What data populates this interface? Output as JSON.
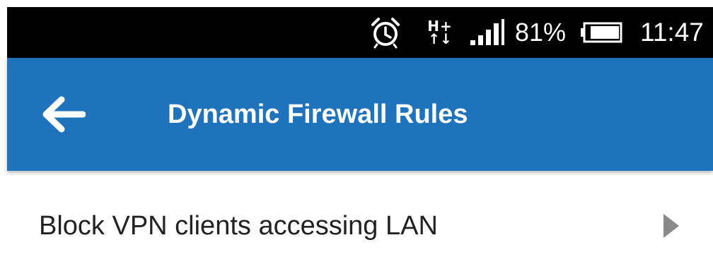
{
  "status_bar": {
    "network_type": "H+",
    "battery_percent": "81%",
    "time": "11:47",
    "icons": [
      "alarm-icon",
      "network-hplus-icon",
      "signal-icon",
      "battery-icon"
    ]
  },
  "app_bar": {
    "title": "Dynamic Firewall Rules",
    "back_icon": "arrow-back-icon",
    "background_color": "#1f72bc"
  },
  "list": {
    "items": [
      {
        "label": "Block VPN clients accessing LAN",
        "icon": "chevron-right-icon"
      }
    ]
  }
}
